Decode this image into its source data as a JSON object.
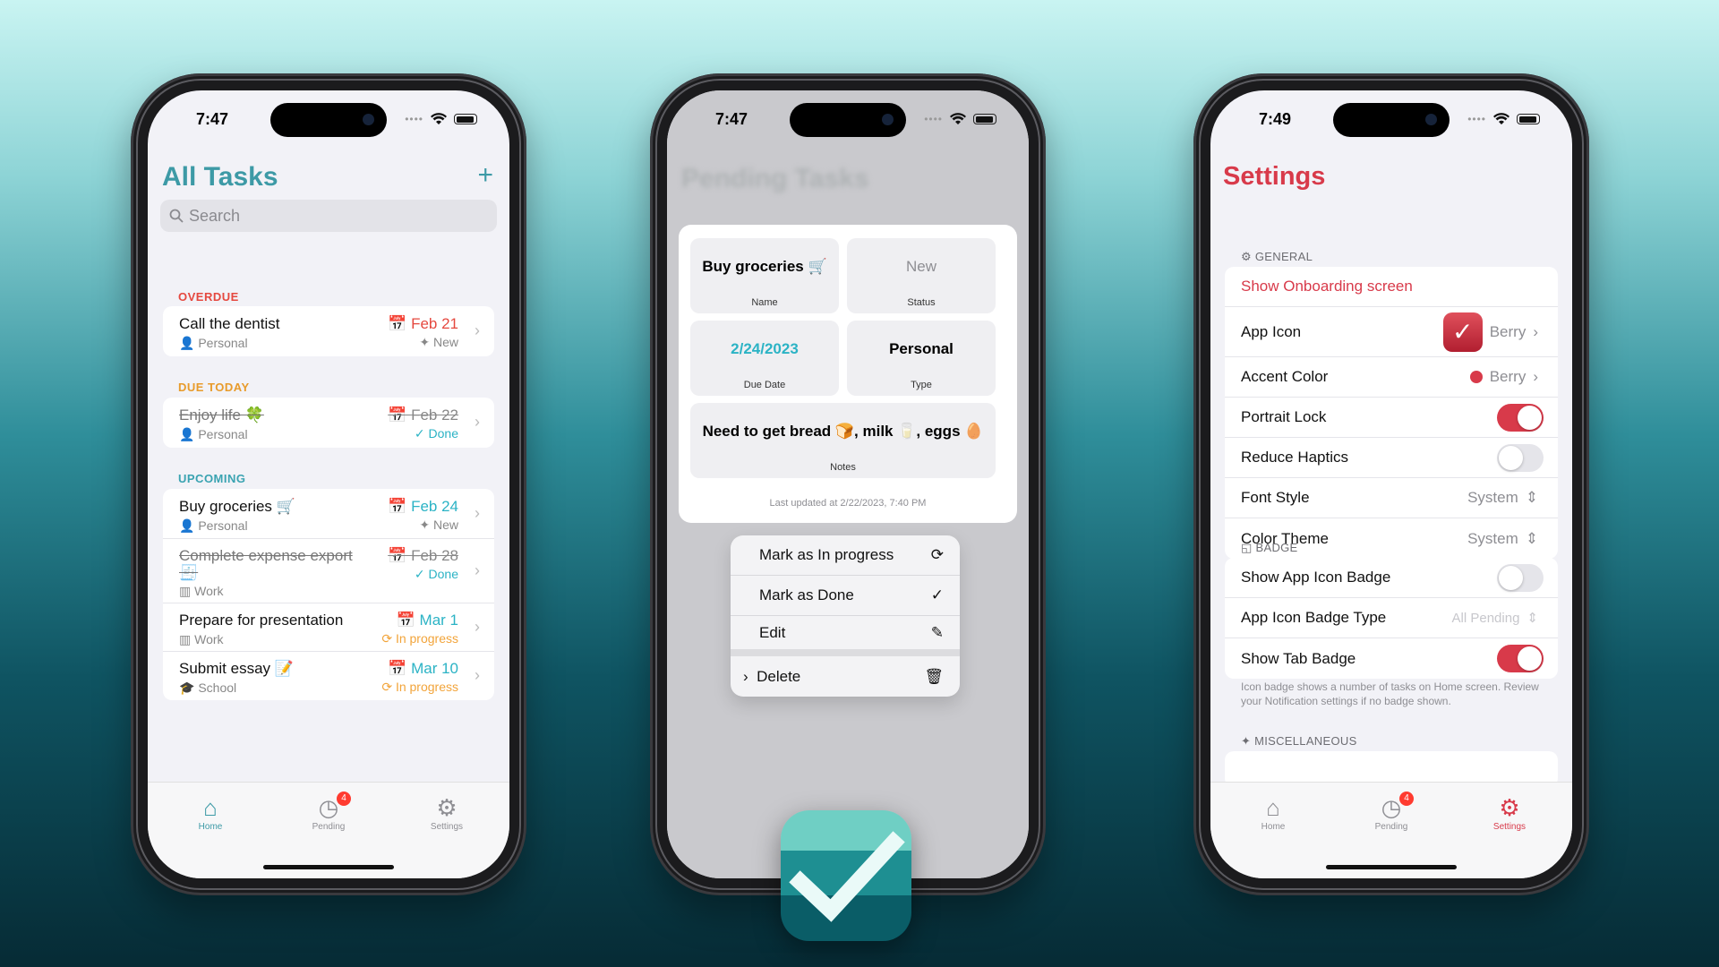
{
  "phone1": {
    "time": "7:47",
    "title": "All Tasks",
    "add_label": "+",
    "search_placeholder": "Search",
    "sections": {
      "overdue": "OVERDUE",
      "due_today": "DUE TODAY",
      "upcoming": "UPCOMING"
    },
    "tasks": [
      {
        "title": "Call the dentist",
        "category": "Personal",
        "date": "Feb 21",
        "status": "New"
      },
      {
        "title": "Enjoy life 🍀",
        "category": "Personal",
        "date": "Feb 22",
        "status": "✓ Done"
      },
      {
        "title": "Buy groceries 🛒",
        "category": "Personal",
        "date": "Feb 24",
        "status": "New"
      },
      {
        "title": "Complete expense export 🧾",
        "category": "Work",
        "date": "Feb 28",
        "status": "✓ Done"
      },
      {
        "title": "Prepare for presentation",
        "category": "Work",
        "date": "Mar 1",
        "status": "In progress"
      },
      {
        "title": "Submit essay 📝",
        "category": "School",
        "date": "Mar 10",
        "status": "In progress"
      }
    ],
    "tabs": {
      "home": "Home",
      "pending": "Pending",
      "settings": "Settings",
      "pending_badge": "4"
    }
  },
  "phone2": {
    "time": "7:47",
    "ghost_title": "Pending Tasks",
    "detail": {
      "name_value": "Buy groceries 🛒",
      "name_label": "Name",
      "status_value": "New",
      "status_label": "Status",
      "due_value": "2/24/2023",
      "due_label": "Due Date",
      "type_value": "Personal",
      "type_label": "Type",
      "notes_value": "Need to get bread 🍞, milk 🥛, eggs 🥚",
      "notes_label": "Notes",
      "updated": "Last updated at 2/22/2023, 7:40 PM"
    },
    "menu": {
      "in_progress": "Mark as In progress",
      "done": "Mark as Done",
      "edit": "Edit",
      "delete": "Delete"
    }
  },
  "phone3": {
    "time": "7:49",
    "title": "Settings",
    "general_header": "GENERAL",
    "onboarding": "Show Onboarding screen",
    "app_icon_label": "App Icon",
    "app_icon_value": "Berry",
    "accent_label": "Accent Color",
    "accent_value": "Berry",
    "portrait_lock": "Portrait Lock",
    "reduce_haptics": "Reduce Haptics",
    "font_style_label": "Font Style",
    "font_style_value": "System",
    "color_theme_label": "Color Theme",
    "color_theme_value": "System",
    "badge_header": "BADGE",
    "show_icon_badge": "Show App Icon Badge",
    "badge_type_label": "App Icon Badge Type",
    "badge_type_value": "All Pending",
    "show_tab_badge": "Show Tab Badge",
    "badge_note": "Icon badge shows a number of tasks on Home screen. Review your Notification settings if no badge shown.",
    "misc_header": "MISCELLANEOUS",
    "tabs": {
      "home": "Home",
      "pending": "Pending",
      "settings": "Settings",
      "pending_badge": "4"
    }
  },
  "colors": {
    "teal": "#3d9aa6",
    "berry": "#d83a4a",
    "overdue_red": "#e5483f",
    "today_orange": "#e89b2b",
    "upcoming_teal": "#3aa3b1",
    "done_teal": "#2bb3c5",
    "progress_orange": "#f2a43a"
  }
}
